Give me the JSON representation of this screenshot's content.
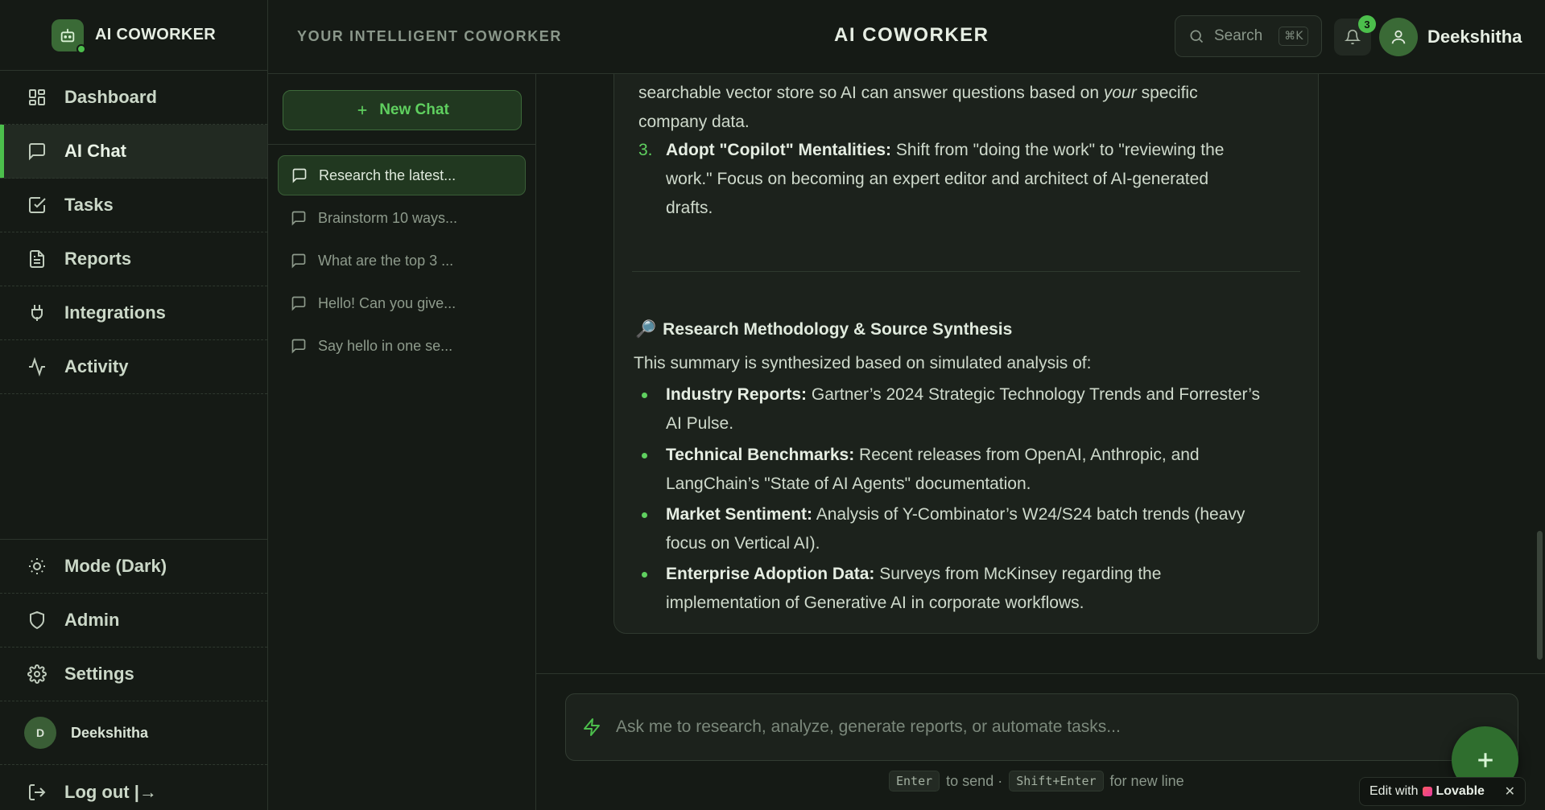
{
  "brand": {
    "name": "AI COWORKER"
  },
  "sidebar": {
    "nav": [
      {
        "label": "Dashboard",
        "icon": "dashboard-grid-icon"
      },
      {
        "label": "AI Chat",
        "icon": "chat-bubble-icon",
        "active": true
      },
      {
        "label": "Tasks",
        "icon": "checkbox-icon"
      },
      {
        "label": "Reports",
        "icon": "document-icon"
      },
      {
        "label": "Integrations",
        "icon": "plug-icon"
      },
      {
        "label": "Activity",
        "icon": "activity-pulse-icon"
      }
    ],
    "bottom": [
      {
        "label": "Mode (Dark)",
        "icon": "sun-icon"
      },
      {
        "label": "Admin",
        "icon": "shield-icon"
      },
      {
        "label": "Settings",
        "icon": "gear-icon"
      }
    ],
    "user": {
      "initial": "D",
      "name": "Deekshitha"
    },
    "logout_label": "Log out |→"
  },
  "header": {
    "tagline": "YOUR INTELLIGENT COWORKER",
    "title": "AI COWORKER",
    "search_label": "Search",
    "search_kbd": "⌘K",
    "notification_count": "3",
    "profile_name": "Deekshitha"
  },
  "chats": {
    "new_chat_label": "New Chat",
    "items": [
      {
        "title": "Research the latest...",
        "active": true
      },
      {
        "title": "Brainstorm 10 ways..."
      },
      {
        "title": "What are the top 3 ..."
      },
      {
        "title": "Hello! Can you give..."
      },
      {
        "title": "Say hello in one se..."
      }
    ]
  },
  "message": {
    "partial_line_1": "searchable vector store so AI can answer questions based on",
    "partial_em": "your",
    "partial_line_1_end": "specific",
    "partial_line_2": "company data.",
    "item3": {
      "number": "3.",
      "label": "Adopt \"Copilot\" Mentalities:",
      "text_l1": "Shift from \"doing the work\" to \"reviewing the",
      "text_l2": "work.\" Focus on becoming an expert editor and architect of AI-generated",
      "text_l3": "drafts."
    },
    "section_emoji": "🔎",
    "section_title": "Research Methodology & Source Synthesis",
    "intro": "This summary is synthesized based on simulated analysis of:",
    "bullets": [
      {
        "label": "Industry Reports:",
        "l1": "Gartner’s 2024 Strategic Technology Trends and Forrester’s",
        "l2": "AI Pulse."
      },
      {
        "label": "Technical Benchmarks:",
        "l1": "Recent releases from OpenAI, Anthropic, and",
        "l2": "LangChain’s \"State of AI Agents\" documentation."
      },
      {
        "label": "Market Sentiment:",
        "l1": "Analysis of Y-Combinator’s W24/S24 batch trends (heavy",
        "l2": "focus on Vertical AI)."
      },
      {
        "label": "Enterprise Adoption Data:",
        "l1": "Surveys from McKinsey regarding the",
        "l2": "implementation of Generative AI in corporate workflows."
      }
    ]
  },
  "composer": {
    "placeholder": "Ask me to research, analyze, generate reports, or automate tasks...",
    "hint_enter": "Enter",
    "hint_to_send": "to send ·",
    "hint_shift": "Shift+Enter",
    "hint_newline": "for new line"
  },
  "lovable": {
    "prefix": "Edit with",
    "brand": "Lovable",
    "close": "✕"
  },
  "colors": {
    "accent": "#4cbf4c",
    "background": "#151a15",
    "card": "#1c221c"
  }
}
